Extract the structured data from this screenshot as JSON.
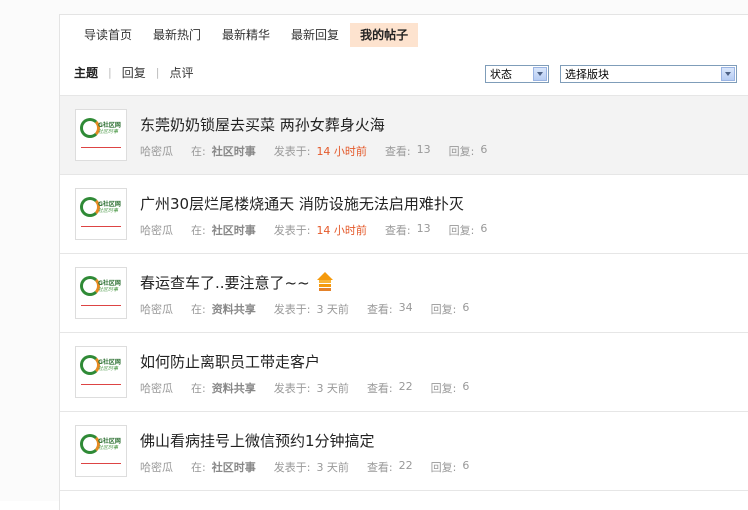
{
  "nav": {
    "tabs": [
      {
        "label": "导读首页"
      },
      {
        "label": "最新热门"
      },
      {
        "label": "最新精华"
      },
      {
        "label": "最新回复"
      },
      {
        "label": "我的帖子"
      }
    ],
    "active_tab_index": 4
  },
  "subnav": {
    "items": [
      {
        "label": "主题"
      },
      {
        "label": "回复"
      },
      {
        "label": "点评"
      }
    ],
    "active_index": 0,
    "status_select": {
      "value": "状态"
    },
    "forum_select": {
      "value": "选择版块"
    }
  },
  "labels": {
    "in": "在:",
    "posted": "发表于:",
    "views": "查看:",
    "replies": "回复:"
  },
  "threads": [
    {
      "title": "东莞奶奶锁屋去买菜 两孙女葬身火海",
      "author": "哈密瓜",
      "forum": "社区时事",
      "time": "14 小时前",
      "time_hot": true,
      "views": "13",
      "replies": "6",
      "has_hot_icon": false
    },
    {
      "title": "广州30层烂尾楼烧通天 消防设施无法启用难扑灭",
      "author": "哈密瓜",
      "forum": "社区时事",
      "time": "14 小时前",
      "time_hot": true,
      "views": "13",
      "replies": "6",
      "has_hot_icon": false
    },
    {
      "title": "春运查车了..要注意了~~",
      "author": "哈密瓜",
      "forum": "资料共享",
      "time": "3 天前",
      "time_hot": false,
      "views": "34",
      "replies": "6",
      "has_hot_icon": true
    },
    {
      "title": "如何防止离职员工带走客户",
      "author": "哈密瓜",
      "forum": "资料共享",
      "time": "3 天前",
      "time_hot": false,
      "views": "22",
      "replies": "6",
      "has_hot_icon": false
    },
    {
      "title": "佛山看病挂号上微信预约1分钟搞定",
      "author": "哈密瓜",
      "forum": "社区时事",
      "time": "3 天前",
      "time_hot": false,
      "views": "22",
      "replies": "6",
      "has_hot_icon": false
    }
  ],
  "colors": {
    "active_tab_bg": "#fde3cf",
    "hot_time": "#e4592a",
    "row_highlight": "#f3f3f3"
  }
}
